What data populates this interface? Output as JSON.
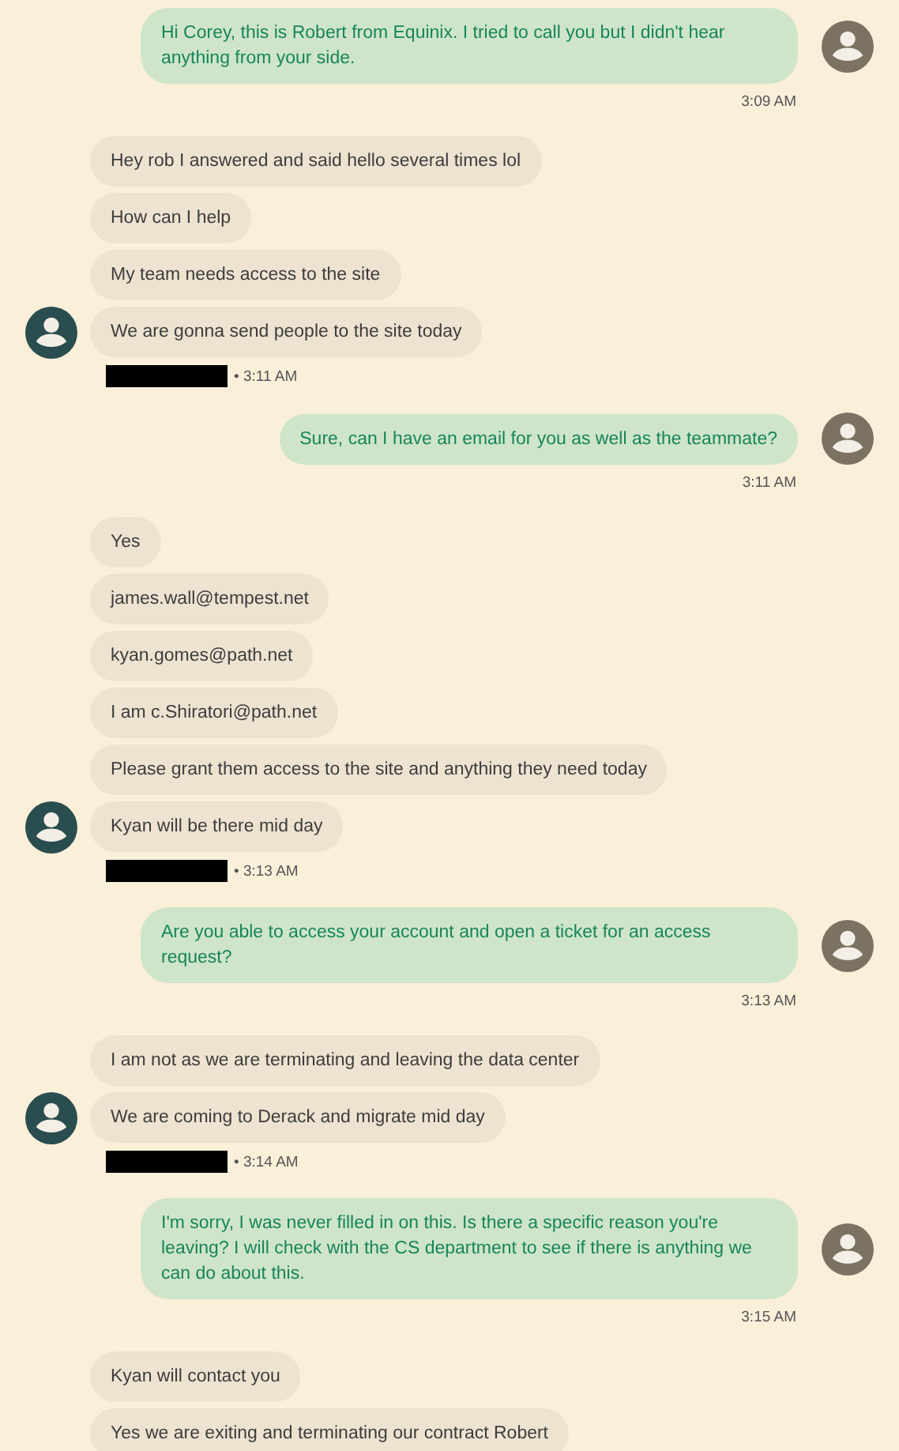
{
  "conversation": [
    {
      "kind": "sent",
      "messages": [
        "Hi Corey, this is Robert from Equinix. I tried to call you but I didn't hear anything from your side."
      ],
      "time": "3:09 AM",
      "avatar": true
    },
    {
      "kind": "received",
      "messages": [
        "Hey rob I answered and said hello several times lol",
        "How can I help",
        "My team needs access to the site",
        "We are gonna send people to the site today"
      ],
      "name_redacted": true,
      "time": "• 3:11 AM",
      "avatar": true
    },
    {
      "kind": "sent",
      "messages": [
        "Sure, can I have an email for you as well as the teammate?"
      ],
      "time": "3:11 AM",
      "avatar": true
    },
    {
      "kind": "received",
      "messages": [
        "Yes",
        "james.wall@tempest.net",
        "kyan.gomes@path.net",
        "I am c.Shiratori@path.net",
        "Please grant them access to the site and anything they need today",
        "Kyan will be there mid day"
      ],
      "name_redacted": true,
      "time": "• 3:13 AM",
      "avatar": true
    },
    {
      "kind": "sent",
      "messages": [
        "Are you able to access your account and open a ticket for an access request?"
      ],
      "time": "3:13 AM",
      "avatar": true
    },
    {
      "kind": "received",
      "messages": [
        "I am not as we are terminating and leaving the data center",
        "We are coming to Derack and migrate mid day"
      ],
      "name_redacted": true,
      "time": "• 3:14 AM",
      "avatar": true
    },
    {
      "kind": "sent",
      "messages": [
        "I'm sorry, I was never filled in on this. Is there a specific reason you're leaving? I will check with the CS department to see if there is anything we can do about this."
      ],
      "time": "3:15 AM",
      "avatar": true
    },
    {
      "kind": "received",
      "messages": [
        "Kyan will contact you",
        "Yes we are exiting and terminating our contract Robert"
      ],
      "avatar": false
    }
  ]
}
